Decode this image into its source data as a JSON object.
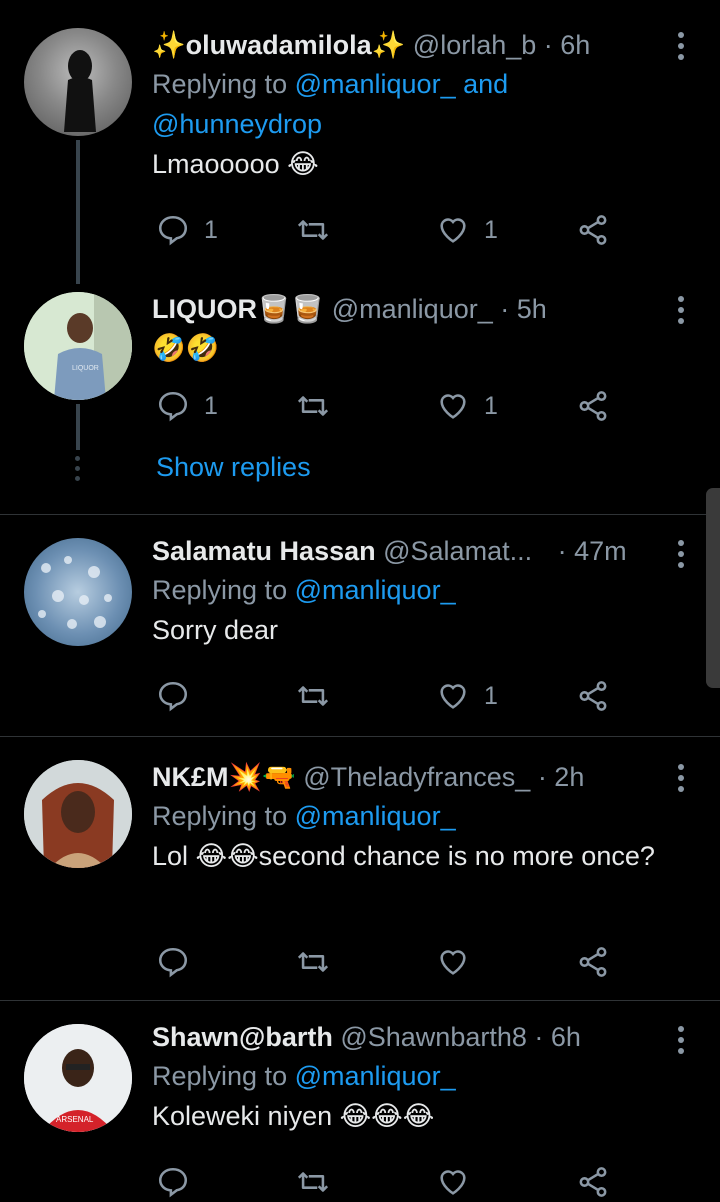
{
  "tweets": [
    {
      "name": "✨oluwadamilola✨",
      "handle": "@lorlah_b",
      "time": "· 6h",
      "replying_prefix": "Replying to ",
      "replying_to": "@manliquor_ and @hunneydrop",
      "text": "Lmaooooo 😂",
      "reply_count": "1",
      "retweet_count": "",
      "like_count": "1"
    },
    {
      "name": "LIQUOR🥃🥃",
      "handle": "@manliquor_",
      "time": "· 5h",
      "text": "🤣🤣",
      "reply_count": "1",
      "retweet_count": "",
      "like_count": "1"
    },
    {
      "name": "Salamatu Hassan",
      "handle": "@Salamat...",
      "time": "· 47m",
      "replying_prefix": "Replying to ",
      "replying_to": "@manliquor_",
      "text": "Sorry dear",
      "reply_count": "",
      "retweet_count": "",
      "like_count": "1"
    },
    {
      "name": "NK£M💥🔫",
      "handle": "@Theladyfrances_",
      "time": "· 2h",
      "replying_prefix": "Replying to ",
      "replying_to": "@manliquor_",
      "text": "Lol 😂😂second chance is no more once?",
      "reply_count": "",
      "retweet_count": "",
      "like_count": ""
    },
    {
      "name": "Shawn@barth",
      "handle": "@Shawnbarth8",
      "time": "· 6h",
      "replying_prefix": "Replying to ",
      "replying_to": "@manliquor_",
      "text": "Koleweki niyen 😂😂😂",
      "reply_count": "",
      "retweet_count": "",
      "like_count": ""
    }
  ],
  "show_replies": "Show replies",
  "colors": {
    "background": "#000000",
    "text": "#e7e9ea",
    "secondary": "#8b98a5",
    "accent": "#1d9bf0",
    "divider": "#2f3336"
  },
  "icons": [
    "reply-icon",
    "retweet-icon",
    "like-icon",
    "share-icon",
    "more-icon"
  ]
}
